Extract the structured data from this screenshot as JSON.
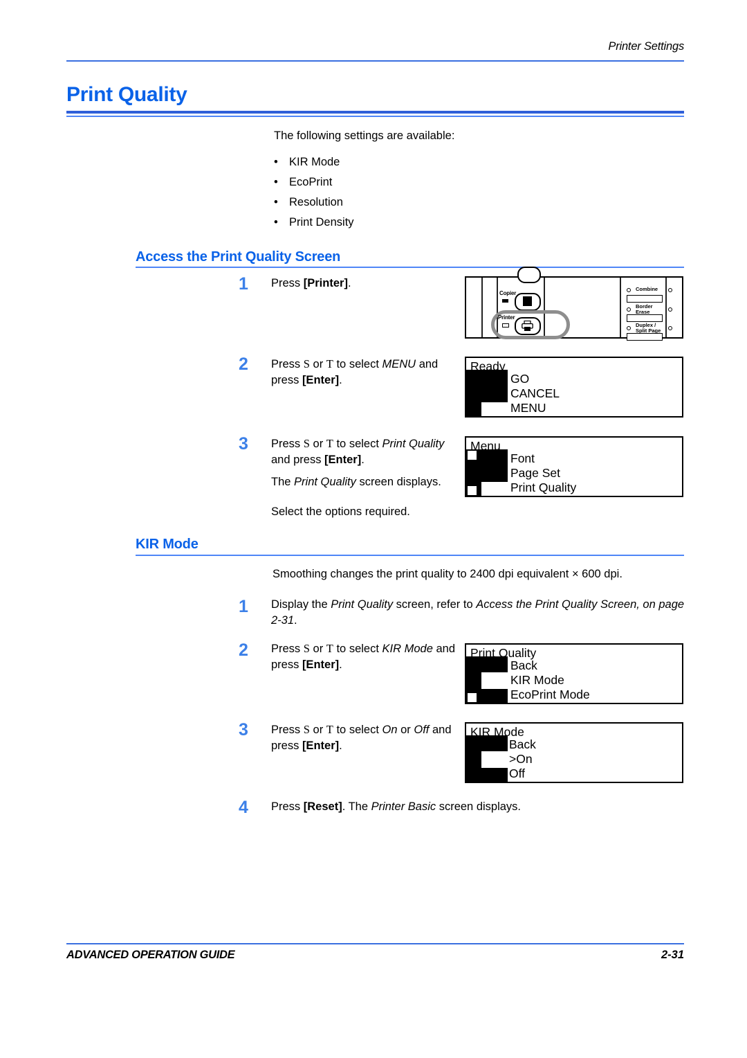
{
  "header": {
    "running_head": "Printer Settings"
  },
  "title": "Print Quality",
  "intro": {
    "lead": "The following settings are available:",
    "bullet_char": "•",
    "items": [
      "KIR Mode",
      "EcoPrint",
      "Resolution",
      "Print Density"
    ]
  },
  "section_access": {
    "heading": "Access the Print Quality Screen",
    "steps": [
      {
        "number": "1",
        "parts": [
          {
            "t": "Press ",
            "s": "n"
          },
          {
            "t": "[Printer]",
            "s": "b"
          },
          {
            "t": ".",
            "s": "n"
          }
        ]
      },
      {
        "number": "2",
        "parts": [
          {
            "t": "Press ",
            "s": "n"
          },
          {
            "t": "S",
            "s": "a"
          },
          {
            "t": " or ",
            "s": "n"
          },
          {
            "t": "T",
            "s": "a"
          },
          {
            "t": " to select ",
            "s": "n"
          },
          {
            "t": "MENU",
            "s": "i"
          },
          {
            "t": " and press ",
            "s": "n"
          },
          {
            "t": "[Enter]",
            "s": "b"
          },
          {
            "t": ".",
            "s": "n"
          }
        ]
      },
      {
        "number": "3",
        "parts": [
          {
            "t": "Press ",
            "s": "n"
          },
          {
            "t": "S",
            "s": "a"
          },
          {
            "t": " or ",
            "s": "n"
          },
          {
            "t": "T",
            "s": "a"
          },
          {
            "t": " to select ",
            "s": "n"
          },
          {
            "t": "Print Quality",
            "s": "i"
          },
          {
            "t": " and press ",
            "s": "n"
          },
          {
            "t": "[Enter]",
            "s": "b"
          },
          {
            "t": ".",
            "s": "n"
          }
        ]
      }
    ],
    "note_1_parts": [
      {
        "t": "The ",
        "s": "n"
      },
      {
        "t": "Print Quality",
        "s": "i"
      },
      {
        "t": " screen displays.",
        "s": "n"
      }
    ],
    "note_2": "Select the options required."
  },
  "section_kir": {
    "heading": "KIR Mode",
    "intro": "Smoothing changes the print quality to 2400 dpi equivalent × 600 dpi.",
    "steps": [
      {
        "number": "1",
        "parts": [
          {
            "t": "Display the ",
            "s": "n"
          },
          {
            "t": "Print Quality",
            "s": "i"
          },
          {
            "t": " screen, refer to ",
            "s": "n"
          },
          {
            "t": "Access the Print Quality Screen, on page 2-31",
            "s": "i"
          },
          {
            "t": ".",
            "s": "n"
          }
        ]
      },
      {
        "number": "2",
        "parts": [
          {
            "t": "Press ",
            "s": "n"
          },
          {
            "t": "S",
            "s": "a"
          },
          {
            "t": " or ",
            "s": "n"
          },
          {
            "t": "T",
            "s": "a"
          },
          {
            "t": " to select ",
            "s": "n"
          },
          {
            "t": "KIR Mode",
            "s": "i"
          },
          {
            "t": " and press ",
            "s": "n"
          },
          {
            "t": "[Enter]",
            "s": "b"
          },
          {
            "t": ".",
            "s": "n"
          }
        ]
      },
      {
        "number": "3",
        "parts": [
          {
            "t": "Press ",
            "s": "n"
          },
          {
            "t": "S",
            "s": "a"
          },
          {
            "t": " or ",
            "s": "n"
          },
          {
            "t": "T",
            "s": "a"
          },
          {
            "t": " to select ",
            "s": "n"
          },
          {
            "t": "On",
            "s": "i"
          },
          {
            "t": " or ",
            "s": "n"
          },
          {
            "t": "Off",
            "s": "i"
          },
          {
            "t": " and press ",
            "s": "n"
          },
          {
            "t": "[Enter]",
            "s": "b"
          },
          {
            "t": ".",
            "s": "n"
          }
        ]
      },
      {
        "number": "4",
        "parts": [
          {
            "t": "Press ",
            "s": "n"
          },
          {
            "t": "[Reset]",
            "s": "b"
          },
          {
            "t": ". The ",
            "s": "n"
          },
          {
            "t": "Printer Basic",
            "s": "i"
          },
          {
            "t": " screen displays.",
            "s": "n"
          }
        ]
      }
    ]
  },
  "lcd_screens": [
    {
      "id": "ready",
      "title": "Ready",
      "items": [
        "GO",
        "CANCEL",
        "MENU"
      ],
      "selected_index": 2
    },
    {
      "id": "menu",
      "title": "Menu",
      "items": [
        "Font",
        "Page Set",
        "Print Quality"
      ],
      "selected_index": 2
    },
    {
      "id": "print-quality",
      "title": "Print Quality",
      "items": [
        "Back",
        "KIR Mode",
        "EcoPrint Mode"
      ],
      "selected_index": 1
    },
    {
      "id": "kir-mode",
      "title": "KIR Mode",
      "items": [
        "Back",
        ">On",
        "Off"
      ],
      "selected_index": 1
    }
  ],
  "control_panel": {
    "keys": [
      {
        "label": "Copier",
        "icon": "copier-key-icon"
      },
      {
        "label": "Printer",
        "icon": "printer-key-icon"
      }
    ],
    "right_labels": [
      "Combine",
      "Border Erase",
      "Duplex / Split Page"
    ],
    "right_label_lines": [
      [
        "Combine"
      ],
      [
        "Border",
        "Erase"
      ],
      [
        "Duplex /",
        "Split Page"
      ]
    ],
    "highlighted_key": "Printer"
  },
  "footer": {
    "guide": "ADVANCED OPERATION GUIDE",
    "page": "2-31"
  },
  "colors": {
    "heading_blue": "#0a62e8",
    "rule_blue": "#3a6fe0",
    "step_number_blue": "#3c80e8"
  }
}
